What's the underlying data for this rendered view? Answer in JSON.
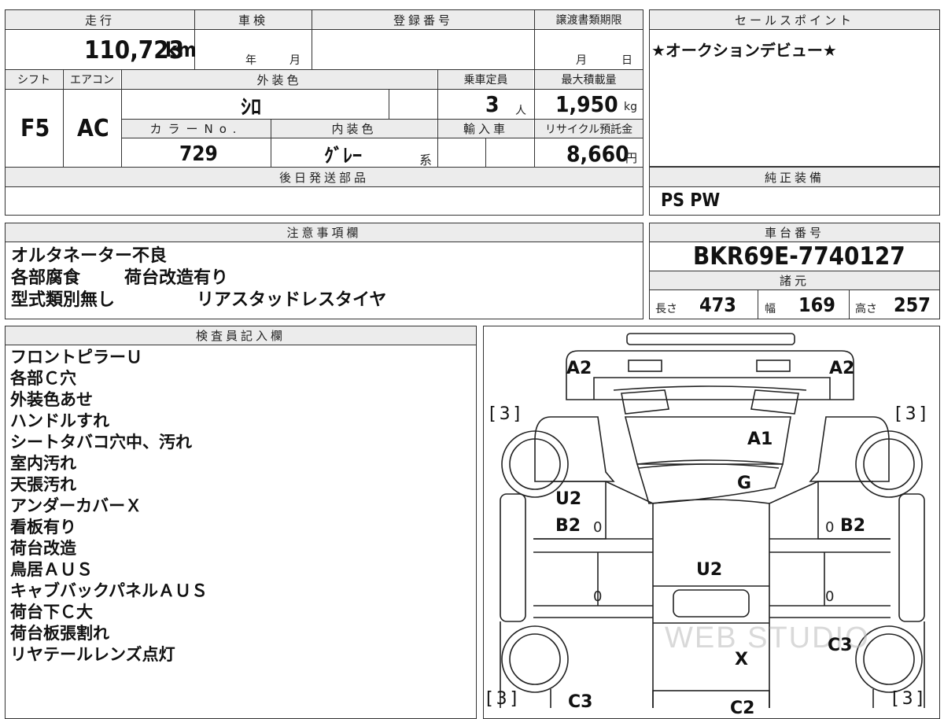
{
  "top": {
    "headers": {
      "mileage": "走行",
      "inspection": "車検",
      "registration": "登録番号",
      "transfer_deadline": "譲渡書類期限",
      "sales_point": "セールスポイント"
    },
    "mileage_value": "110,723",
    "mileage_unit": "km",
    "year_label": "年",
    "month_label": "月",
    "deadline_month": "月",
    "deadline_day": "日",
    "sales_point_text": "★オークションデビュー★"
  },
  "specs": {
    "headers": {
      "shift": "シフト",
      "aircon": "エアコン",
      "exterior_color": "外装色",
      "capacity": "乗車定員",
      "max_load": "最大積載量",
      "color_no": "カラーNo.",
      "interior_color": "内装色",
      "import": "輸入車",
      "recycle": "リサイクル預託金"
    },
    "shift": "F5",
    "aircon": "AC",
    "exterior_color": "ｼﾛ",
    "capacity": "3",
    "capacity_unit": "人",
    "max_load": "1,950",
    "max_load_unit": "kg",
    "color_no": "729",
    "interior_color": "ｸﾞﾚｰ",
    "interior_suffix": "系",
    "recycle": "8,660",
    "recycle_unit": "円"
  },
  "later_parts": {
    "header": "後日発送部品",
    "text": ""
  },
  "genuine_equipment": {
    "header": "純正装備",
    "text": "PS PW"
  },
  "notes": {
    "header": "注意事項欄",
    "lines": [
      [
        "オルタネーター不良",
        ""
      ],
      [
        "各部腐食",
        "荷台改造有り"
      ],
      [
        "型式類別無し",
        "リアスタッドレスタイヤ"
      ]
    ]
  },
  "chassis": {
    "header": "車台番号",
    "number": "BKR69E-7740127",
    "dims_header": "諸元",
    "length_label": "長さ",
    "length": "473",
    "width_label": "幅",
    "width": "169",
    "height_label": "高さ",
    "height": "257"
  },
  "inspector": {
    "header": "検査員記入欄",
    "items": [
      "フロントピラーＵ",
      "各部Ｃ穴",
      "外装色あせ",
      "ハンドルすれ",
      "シートタバコ穴中、汚れ",
      "室内汚れ",
      "天張汚れ",
      "アンダーカバーＸ",
      "看板有り",
      "荷台改造",
      "鳥居ＡＵＳ",
      "キャブバックパネルＡＵＳ",
      "荷台下Ｃ大",
      "荷台板張割れ",
      "リヤテールレンズ点灯"
    ]
  },
  "diagram": {
    "marks": {
      "a2_left": "A2",
      "a2_right": "A2",
      "a1": "A1",
      "g": "G",
      "u2_left": "U2",
      "b2_left": "B2",
      "b2_right": "B2",
      "u2_center": "U2",
      "c3_right": "C3",
      "x": "X",
      "c3_left": "C3",
      "c2": "C2",
      "bracket_tl": "[3]",
      "bracket_tr": "[3]",
      "bracket_bl": "[3]",
      "bracket_br": "[3]",
      "zero_1": "0",
      "zero_2": "0",
      "zero_3": "0",
      "zero_4": "0"
    },
    "watermark": "WEB STUDIO"
  }
}
